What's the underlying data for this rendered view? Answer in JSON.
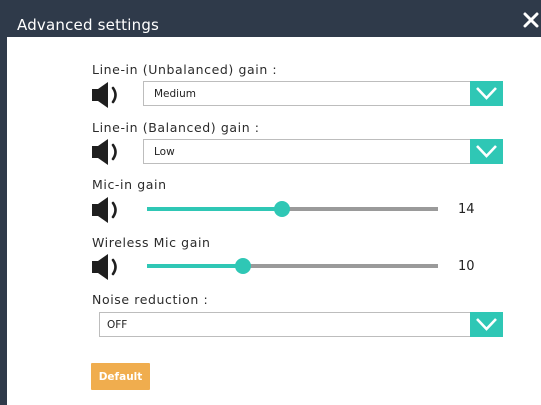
{
  "dialog": {
    "title": "Advanced settings",
    "close_icon": "close-icon"
  },
  "line_in_unbalanced": {
    "label": "Line-in (Unbalanced) gain :",
    "value": "Medium",
    "icon": "speaker-icon"
  },
  "line_in_balanced": {
    "label": "Line-in (Balanced) gain :",
    "value": "Low",
    "icon": "speaker-icon"
  },
  "mic_in": {
    "label": "Mic-in gain",
    "value": "14",
    "fraction": 0.465,
    "icon": "speaker-icon"
  },
  "wireless_mic": {
    "label": "Wireless Mic gain",
    "value": "10",
    "fraction": 0.33,
    "icon": "speaker-icon"
  },
  "noise_reduction": {
    "label": "Noise reduction :",
    "value": "OFF"
  },
  "buttons": {
    "default_label": "Default"
  },
  "colors": {
    "accent": "#2fc7b5",
    "titlebar": "#2f3a4a",
    "default_button": "#f0ad4e"
  }
}
